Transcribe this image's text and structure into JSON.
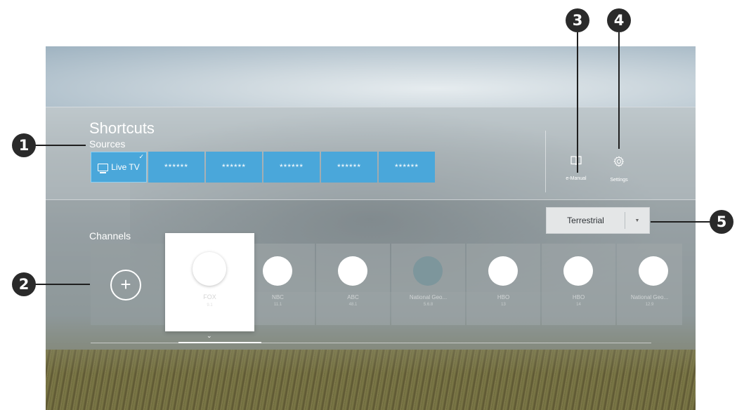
{
  "shortcuts": {
    "title": "Shortcuts",
    "sources_label": "Sources",
    "sources": [
      {
        "label": "Live TV",
        "icon": "tv-icon",
        "selected": true
      },
      {
        "label": "******"
      },
      {
        "label": "******"
      },
      {
        "label": "******"
      },
      {
        "label": "******"
      },
      {
        "label": "******"
      }
    ],
    "tools": [
      {
        "label": "e-Manual",
        "icon": "book-icon"
      },
      {
        "label": "Settings",
        "icon": "gear-icon"
      }
    ]
  },
  "channels": {
    "label": "Channels",
    "filter": "Terrestrial",
    "focused": {
      "name": "FOX",
      "number": "9.1"
    },
    "items": [
      {
        "name": "NBC",
        "number": "11.1"
      },
      {
        "name": "ABC",
        "number": "48.1"
      },
      {
        "name": "National Geo...",
        "number": "5.6.8"
      },
      {
        "name": "HBO",
        "number": "13"
      },
      {
        "name": "HBO",
        "number": "14"
      },
      {
        "name": "National Geo...",
        "number": "12.9"
      }
    ]
  },
  "callouts": {
    "b1": "1",
    "b2": "2",
    "b3": "3",
    "b4": "4",
    "b5": "5"
  },
  "colors": {
    "source_tile": "#4aa7da",
    "callout": "#2a2a2a"
  }
}
